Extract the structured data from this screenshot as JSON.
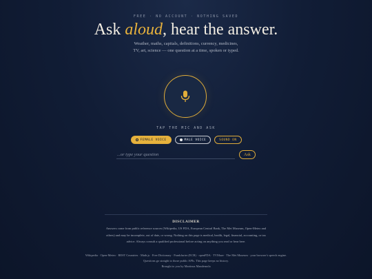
{
  "header": {
    "eyebrow": "FREE · NO ACCOUNT · NOTHING SAVED",
    "title_pre": "Ask ",
    "title_accent": "aloud",
    "title_post": ", hear the answer.",
    "subtitle": "Weather, maths, capitals, definitions, currency, medicines, TV, art, science — one question at a time, spoken or typed."
  },
  "mic": {
    "icon": "microphone-icon",
    "accent_color": "#e1ad3a"
  },
  "tap_label": "TAP THE MIC AND ASK",
  "voice_options": {
    "female": "FEMALE VOICE",
    "male": "MALE VOICE",
    "sound": "SOUND ON"
  },
  "question": {
    "placeholder": "...or type your question",
    "value": "",
    "ask_label": "Ask"
  },
  "disclaimer": {
    "heading": "DISCLAIMER",
    "body": "Answers come from public reference sources (Wikipedia, US FDA, European Central Bank, The Met Museum, Open-Meteo and others) and may be incomplete, out of date, or wrong. Nothing on this page is medical, health, legal, financial, accounting, or tax advice. Always consult a qualified professional before acting on anything you read or hear here."
  },
  "footer": {
    "sources": "Wikipedia · Open-Meteo · REST Countries · Math.js · Free Dictionary · Frankfurter (ECB) · openFDA · TVMaze · The Met Museum · your browser's speech engine.",
    "privacy": "Questions go straight to those public APIs. This page keeps no history.",
    "credit": "Brought to you by Martinus Mandemola"
  },
  "colors": {
    "background": "#111d36",
    "accent": "#e1ad3a",
    "text": "#e8e2d2"
  }
}
